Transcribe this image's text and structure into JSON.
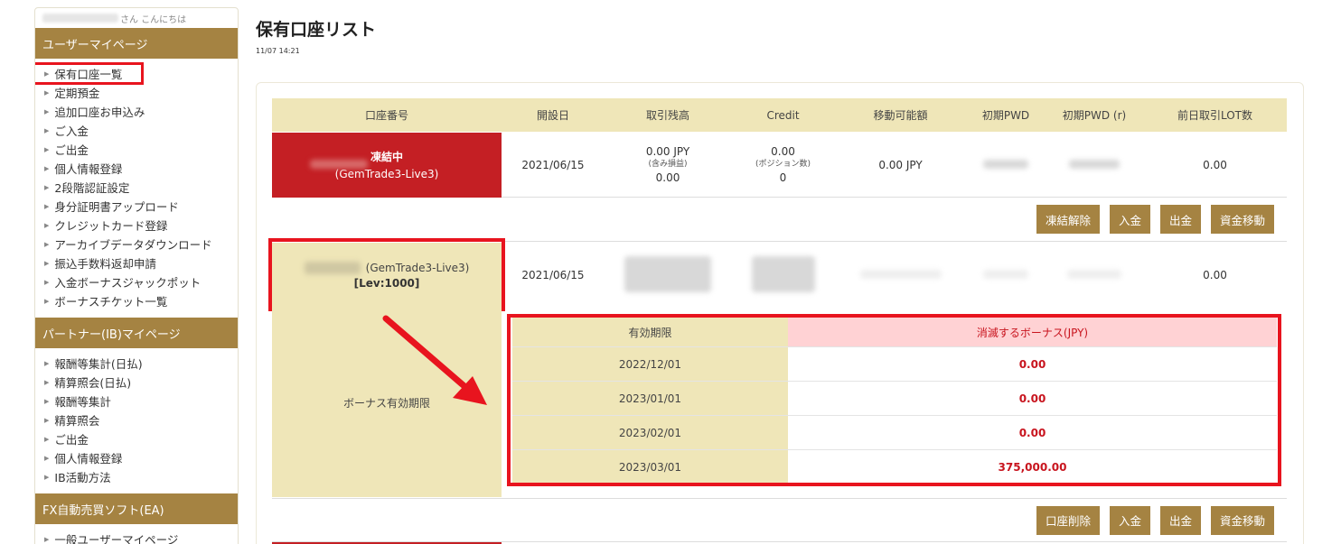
{
  "sidebar": {
    "greeting": "さん こんにちは",
    "sections": [
      {
        "title": "ユーザーマイページ",
        "items": [
          "保有口座一覧",
          "定期預金",
          "追加口座お申込み",
          "ご入金",
          "ご出金",
          "個人情報登録",
          "2段階認証設定",
          "身分証明書アップロード",
          "クレジットカード登録",
          "アーカイブデータダウンロード",
          "振込手数料返却申請",
          "入金ボーナスジャックポット",
          "ボーナスチケット一覧"
        ]
      },
      {
        "title": "パートナー(IB)マイページ",
        "items": [
          "報酬等集計(日払)",
          "精算照会(日払)",
          "報酬等集計",
          "精算照会",
          "ご出金",
          "個人情報登録",
          "IB活動方法"
        ]
      },
      {
        "title": "FX自動売買ソフト(EA)",
        "items": [
          "一般ユーザーマイページ"
        ]
      }
    ]
  },
  "page": {
    "title": "保有口座リスト",
    "time": "11/07 14:21"
  },
  "table": {
    "headers": [
      "口座番号",
      "開設日",
      "取引残高",
      "Credit",
      "移動可能額",
      "初期PWD",
      "初期PWD (r)",
      "前日取引LOT数"
    ],
    "row1": {
      "status": "凍結中",
      "server": "(GemTrade3-Live3)",
      "open_date": "2021/06/15",
      "balance": "0.00 JPY",
      "balance_note": "(含み損益)",
      "balance_sub": "0.00",
      "credit": "0.00",
      "credit_note": "(ポジション数)",
      "credit_sub": "0",
      "movable": "0.00 JPY",
      "lot": "0.00"
    },
    "row1_buttons": [
      "凍結解除",
      "入金",
      "出金",
      "資金移動"
    ],
    "row2": {
      "server": "(GemTrade3-Live3)",
      "lev": "[Lev:1000]",
      "open_date": "2021/06/15",
      "lot": "0.00"
    },
    "bonus": {
      "label": "ボーナス有効期限",
      "col_expiry": "有効期限",
      "col_amount": "消滅するボーナス(JPY)",
      "rows": [
        {
          "date": "2022/12/01",
          "amount": "0.00"
        },
        {
          "date": "2023/01/01",
          "amount": "0.00"
        },
        {
          "date": "2023/02/01",
          "amount": "0.00"
        },
        {
          "date": "2023/03/01",
          "amount": "375,000.00"
        }
      ]
    },
    "row2_buttons": [
      "口座削除",
      "入金",
      "出金",
      "資金移動"
    ]
  },
  "colors": {
    "accent": "#a58342",
    "frozen": "#c41f24",
    "highlight": "#e8141e",
    "header_bg": "#efe6b8",
    "bonus_header": "#ffd2d4"
  }
}
